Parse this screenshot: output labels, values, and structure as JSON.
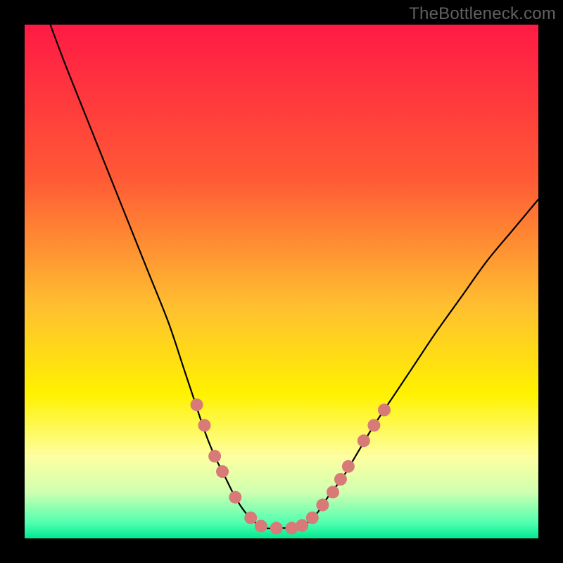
{
  "watermark": "TheBottleneck.com",
  "chart_data": {
    "type": "line",
    "title": "",
    "xlabel": "",
    "ylabel": "",
    "xlim": [
      0,
      100
    ],
    "ylim": [
      0,
      100
    ],
    "curve": [
      {
        "x": 5,
        "y": 100
      },
      {
        "x": 8,
        "y": 92
      },
      {
        "x": 12,
        "y": 82
      },
      {
        "x": 16,
        "y": 72
      },
      {
        "x": 20,
        "y": 62
      },
      {
        "x": 24,
        "y": 52
      },
      {
        "x": 28,
        "y": 42
      },
      {
        "x": 31,
        "y": 33
      },
      {
        "x": 33,
        "y": 27
      },
      {
        "x": 35,
        "y": 21
      },
      {
        "x": 37,
        "y": 16
      },
      {
        "x": 39,
        "y": 12
      },
      {
        "x": 41,
        "y": 8
      },
      {
        "x": 43,
        "y": 5
      },
      {
        "x": 45,
        "y": 3
      },
      {
        "x": 47,
        "y": 2
      },
      {
        "x": 49,
        "y": 2
      },
      {
        "x": 51,
        "y": 2
      },
      {
        "x": 53,
        "y": 2
      },
      {
        "x": 55,
        "y": 3
      },
      {
        "x": 57,
        "y": 5
      },
      {
        "x": 59,
        "y": 8
      },
      {
        "x": 62,
        "y": 12
      },
      {
        "x": 65,
        "y": 17
      },
      {
        "x": 68,
        "y": 22
      },
      {
        "x": 72,
        "y": 28
      },
      {
        "x": 76,
        "y": 34
      },
      {
        "x": 80,
        "y": 40
      },
      {
        "x": 85,
        "y": 47
      },
      {
        "x": 90,
        "y": 54
      },
      {
        "x": 95,
        "y": 60
      },
      {
        "x": 100,
        "y": 66
      }
    ],
    "dots": [
      {
        "x": 33.5,
        "y": 26
      },
      {
        "x": 35,
        "y": 22
      },
      {
        "x": 37,
        "y": 16
      },
      {
        "x": 38.5,
        "y": 13
      },
      {
        "x": 41,
        "y": 8
      },
      {
        "x": 44,
        "y": 4
      },
      {
        "x": 46,
        "y": 2.4
      },
      {
        "x": 49,
        "y": 2
      },
      {
        "x": 52,
        "y": 2
      },
      {
        "x": 54,
        "y": 2.5
      },
      {
        "x": 56,
        "y": 4
      },
      {
        "x": 58,
        "y": 6.5
      },
      {
        "x": 60,
        "y": 9
      },
      {
        "x": 61.5,
        "y": 11.5
      },
      {
        "x": 63,
        "y": 14
      },
      {
        "x": 66,
        "y": 19
      },
      {
        "x": 68,
        "y": 22
      },
      {
        "x": 70,
        "y": 25
      }
    ],
    "background_gradient": {
      "stops": [
        {
          "offset": 0.0,
          "color": "#ff1a45"
        },
        {
          "offset": 0.3,
          "color": "#ff5a35"
        },
        {
          "offset": 0.55,
          "color": "#ffc030"
        },
        {
          "offset": 0.72,
          "color": "#fff200"
        },
        {
          "offset": 0.84,
          "color": "#feffa0"
        },
        {
          "offset": 0.91,
          "color": "#d0ffb0"
        },
        {
          "offset": 0.97,
          "color": "#50ffb0"
        },
        {
          "offset": 1.0,
          "color": "#00e890"
        }
      ]
    },
    "dot_color": "#d87a78",
    "curve_color": "#000000"
  }
}
